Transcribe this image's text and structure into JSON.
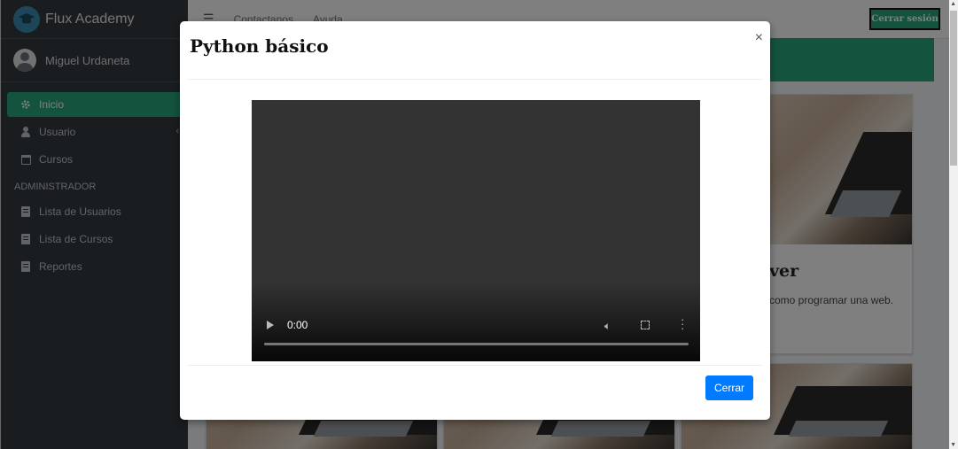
{
  "brand": {
    "name": "Flux Academy",
    "icon": "graduation-cap-icon"
  },
  "user": {
    "name": "Miguel Urdaneta"
  },
  "nav": {
    "items": [
      {
        "label": "Inicio",
        "icon": "gear-icon",
        "active": true
      },
      {
        "label": "Usuario",
        "icon": "user-icon",
        "has_chevron": true
      },
      {
        "label": "Cursos",
        "icon": "calendar-icon"
      }
    ],
    "admin_header": "ADMINISTRADOR",
    "admin_items": [
      {
        "label": "Lista de Usuarios",
        "icon": "book-icon"
      },
      {
        "label": "Lista de Cursos",
        "icon": "book-icon"
      },
      {
        "label": "Reportes",
        "icon": "book-icon"
      }
    ]
  },
  "topbar": {
    "links": [
      "Contactanos",
      "Ayuda"
    ],
    "logout_label": "Cerrar sesión"
  },
  "background_card": {
    "title_fragment": "ver",
    "text_fragment": "como programar una web."
  },
  "modal": {
    "title": "Python básico",
    "close_symbol": "×",
    "video": {
      "time": "0:00",
      "progress": 0
    },
    "close_button_label": "Cerrar"
  },
  "colors": {
    "accent": "#28a77a",
    "primary_button": "#007bff",
    "sidebar_bg": "#343a40"
  }
}
